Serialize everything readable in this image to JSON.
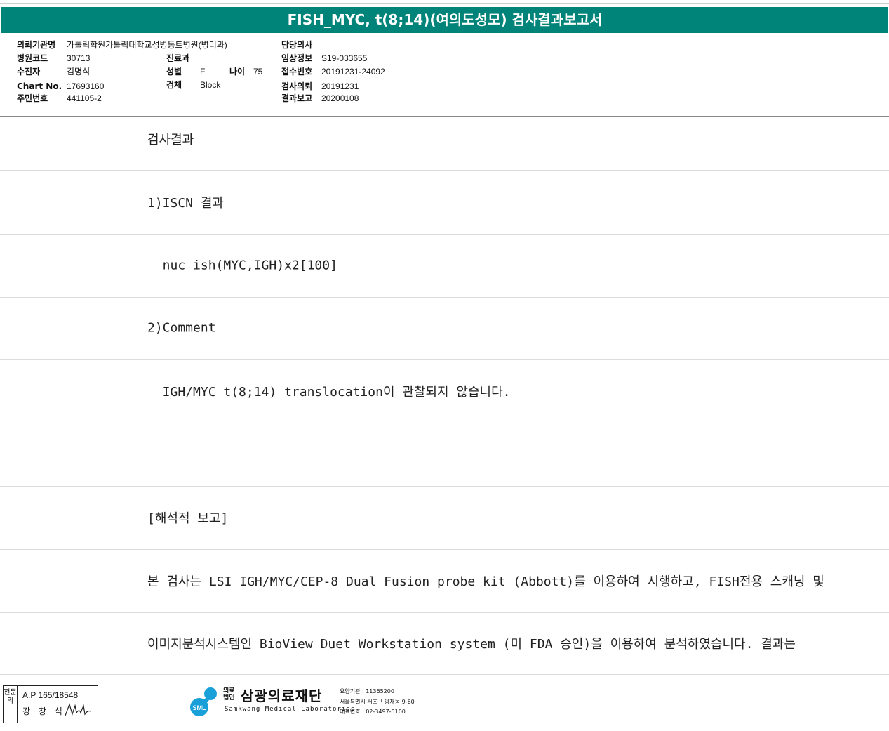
{
  "title": "FISH_MYC, t(8;14)(여의도성모) 검사결과보고서",
  "info": {
    "hospital_label": "의뢰기관명",
    "hospital_value": "가톨릭학원가톨릭대학교성병동트병원(병리과)",
    "doctor_label": "담당의사",
    "code_label": "병원코드",
    "code_value": "30713",
    "dept_label": "진료과",
    "clinical_label": "임상정보",
    "clinical_value": "S19-033655",
    "patient_label": "수진자",
    "patient_value": "김명식",
    "sex_label": "성별",
    "sex_value": "F",
    "age_label": "나이",
    "age_value": "75",
    "receipt_label": "접수번호",
    "receipt_value": "20191231-24092",
    "chart_label": "Chart No.",
    "chart_value": "17693160",
    "specimen_label": "검체",
    "specimen_value": "Block",
    "request_label": "검사의뢰",
    "request_value": "20191231",
    "id_label": "주민번호",
    "id_value": "441105-2",
    "report_label": "결과보고",
    "report_value": "20200108"
  },
  "rows": [
    "검사결과",
    "1)ISCN 결과",
    "  nuc ish(MYC,IGH)x2[100]",
    "2)Comment",
    "  IGH/MYC t(8;14) translocation이 관찰되지 않습니다.",
    "",
    "[해석적 보고]",
    "본 검사는 LSI IGH/MYC/CEP-8 Dual Fusion probe kit (Abbott)를 이용하여 시행하고, FISH전용 스캐닝 및",
    "이미지분석시스템인 BioView Duet Workstation system (미 FDA 승인)을 이용하여 분석하였습니다. 결과는"
  ],
  "footer": {
    "stamp_side": "전문의",
    "stamp_line1": "A.P 165/18548",
    "stamp_line2": "강 창 석",
    "logo_text": "SML",
    "org_prefix": "의료\n법인",
    "org_name": "삼광의료재단",
    "org_english": "Samkwang Medical Laboratories",
    "addr1": "요양기관 : 11365200",
    "addr2": "서울특별시 서초구 양재동 9-60",
    "addr3": "대표번호 : 02-3497-5100"
  },
  "colors": {
    "header_bg": "#008378",
    "divider": "#dcdcdc"
  }
}
